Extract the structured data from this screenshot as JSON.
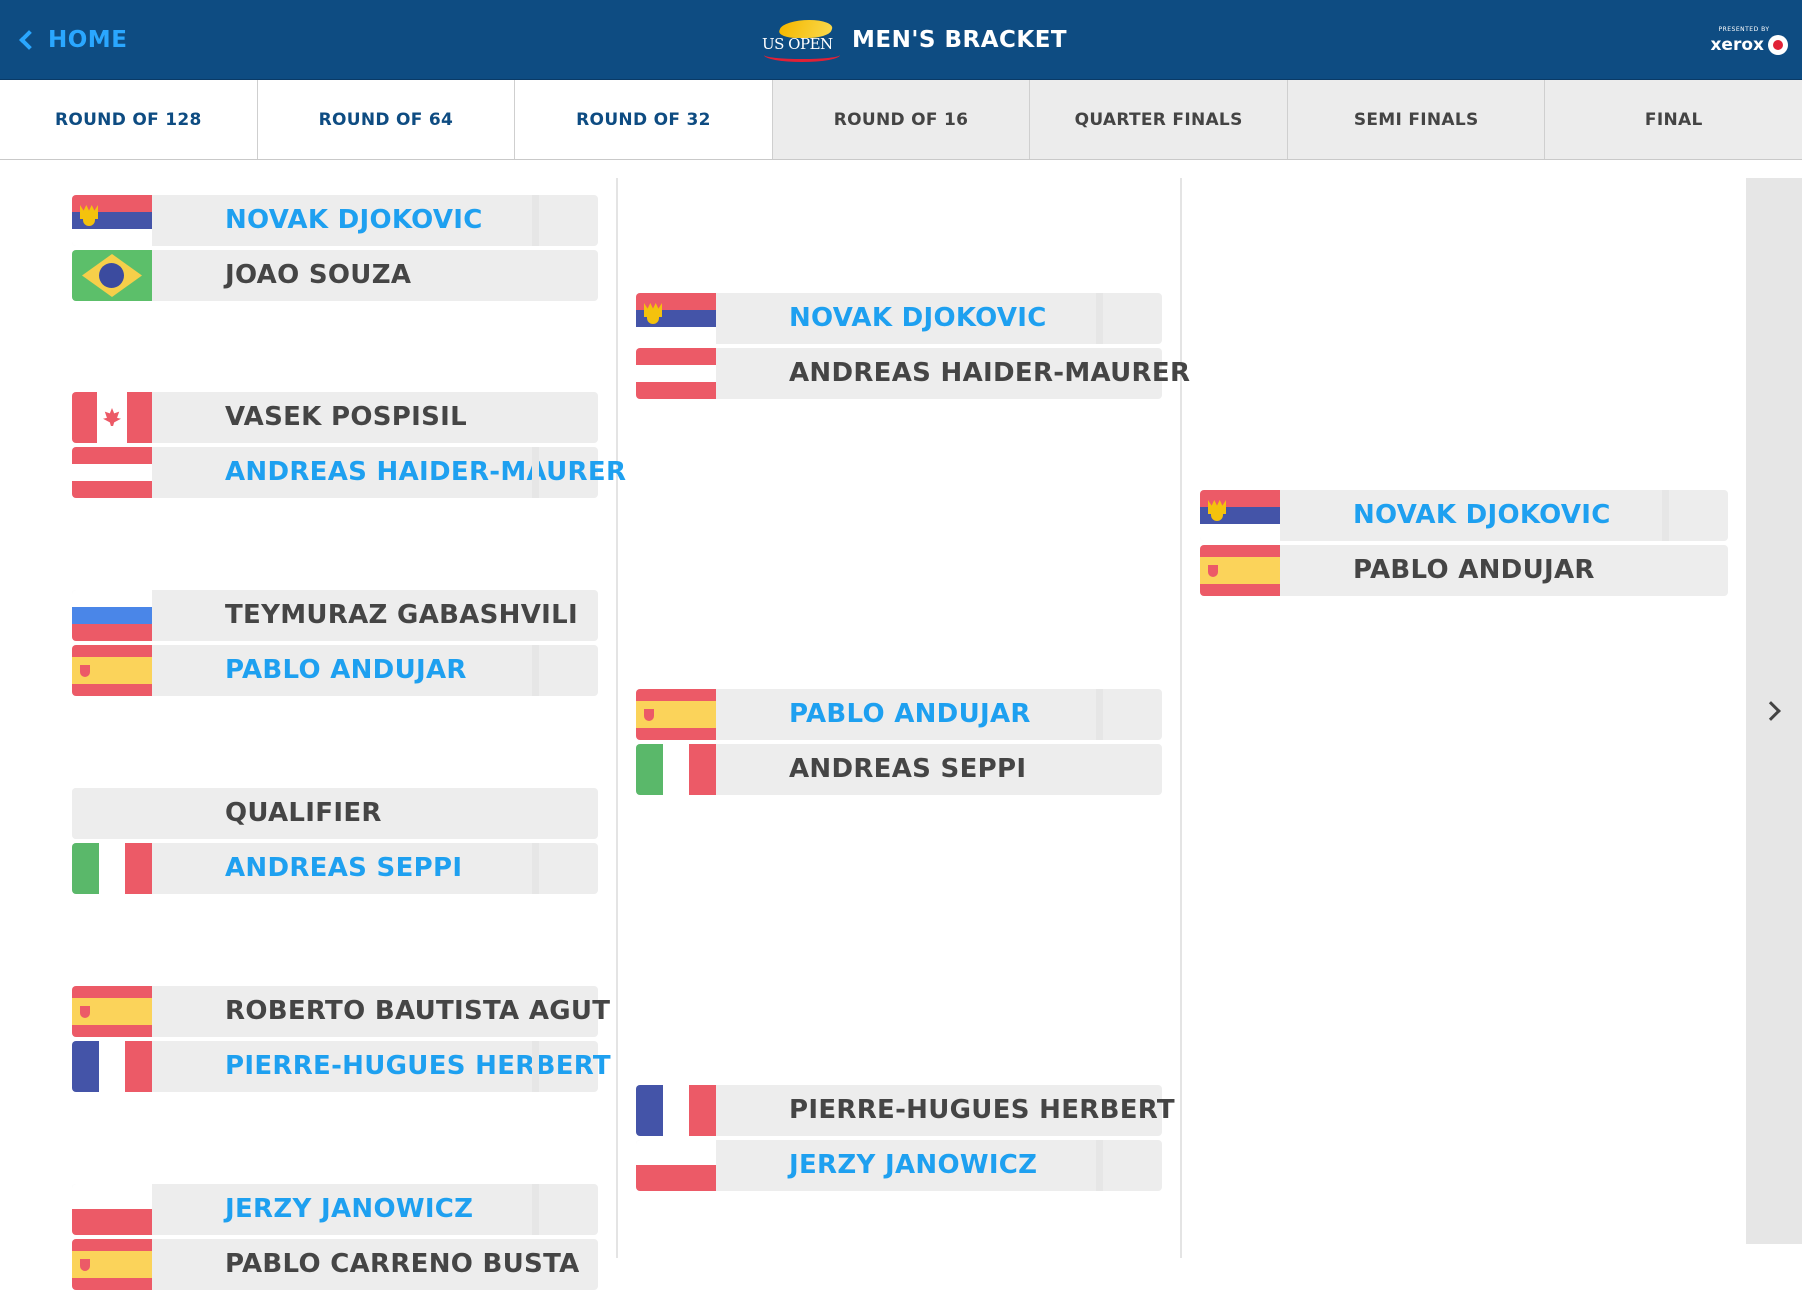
{
  "header": {
    "home_label": "HOME",
    "logo_text": "US OPEN",
    "title": "MEN'S BRACKET",
    "sponsor_presented": "PRESENTED BY",
    "sponsor_name": "xerox"
  },
  "tabs": [
    {
      "label": "ROUND OF 128",
      "active": true
    },
    {
      "label": "ROUND OF 64",
      "active": true
    },
    {
      "label": "ROUND OF 32",
      "active": true
    },
    {
      "label": "ROUND OF 16",
      "active": false
    },
    {
      "label": "QUARTER FINALS",
      "active": false
    },
    {
      "label": "SEMI FINALS",
      "active": false
    },
    {
      "label": "FINAL",
      "active": false
    }
  ],
  "colors": {
    "header_bg": "#0e4c82",
    "accent": "#1ea0f0",
    "loser_text": "#454545",
    "row_bg": "#ededed"
  },
  "columns": [
    {
      "matches": [
        {
          "players": [
            {
              "name": "NOVAK DJOKOVIC",
              "winner": true,
              "flag": "serbia"
            },
            {
              "name": "JOAO SOUZA",
              "winner": false,
              "flag": "brazil"
            }
          ]
        },
        {
          "players": [
            {
              "name": "VASEK POSPISIL",
              "winner": false,
              "flag": "canada"
            },
            {
              "name": "ANDREAS HAIDER-MAURER",
              "winner": true,
              "flag": "austria"
            }
          ]
        },
        {
          "players": [
            {
              "name": "TEYMURAZ GABASHVILI",
              "winner": false,
              "flag": "russia"
            },
            {
              "name": "PABLO ANDUJAR",
              "winner": true,
              "flag": "spain"
            }
          ]
        },
        {
          "players": [
            {
              "name": "QUALIFIER",
              "winner": false,
              "flag": "none"
            },
            {
              "name": "ANDREAS SEPPI",
              "winner": true,
              "flag": "italy"
            }
          ]
        },
        {
          "players": [
            {
              "name": "ROBERTO BAUTISTA AGUT",
              "winner": false,
              "flag": "spain"
            },
            {
              "name": "PIERRE-HUGUES HERBERT",
              "winner": true,
              "flag": "france"
            }
          ]
        },
        {
          "players": [
            {
              "name": "JERZY JANOWICZ",
              "winner": true,
              "flag": "poland"
            },
            {
              "name": "PABLO CARRENO BUSTA",
              "winner": false,
              "flag": "spain"
            }
          ]
        }
      ]
    },
    {
      "matches": [
        {
          "players": [
            {
              "name": "NOVAK DJOKOVIC",
              "winner": true,
              "flag": "serbia"
            },
            {
              "name": "ANDREAS HAIDER-MAURER",
              "winner": false,
              "flag": "austria"
            }
          ]
        },
        {
          "players": [
            {
              "name": "PABLO ANDUJAR",
              "winner": true,
              "flag": "spain"
            },
            {
              "name": "ANDREAS SEPPI",
              "winner": false,
              "flag": "italy"
            }
          ]
        },
        {
          "players": [
            {
              "name": "PIERRE-HUGUES HERBERT",
              "winner": false,
              "flag": "france"
            },
            {
              "name": "JERZY JANOWICZ",
              "winner": true,
              "flag": "poland"
            }
          ]
        }
      ]
    },
    {
      "matches": [
        {
          "players": [
            {
              "name": "NOVAK DJOKOVIC",
              "winner": true,
              "flag": "serbia"
            },
            {
              "name": "PABLO ANDUJAR",
              "winner": false,
              "flag": "spain"
            }
          ]
        }
      ]
    }
  ],
  "next_icon": "chevron-right-icon"
}
